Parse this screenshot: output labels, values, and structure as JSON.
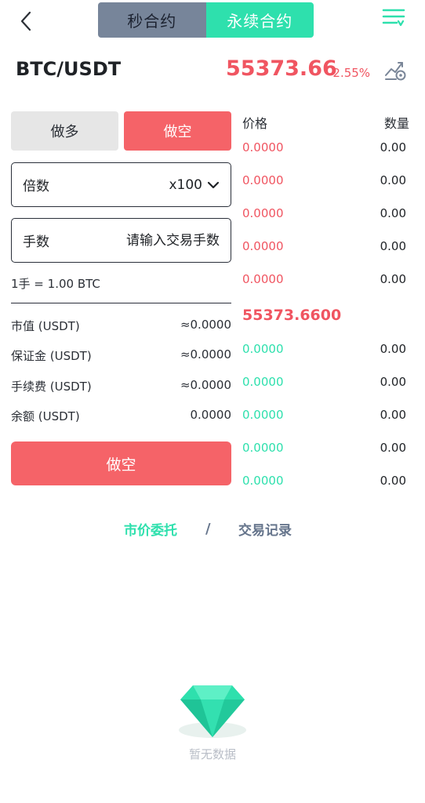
{
  "nav": {
    "tabs": [
      {
        "label": "秒合约",
        "active": false
      },
      {
        "label": "永续合约",
        "active": true
      }
    ],
    "back_icon": "chevron-left-icon",
    "menu_icon": "filter-menu-icon"
  },
  "header": {
    "pair": "BTC/USDT",
    "price": "55373.66",
    "change": "-2.55%",
    "chart_icon": "chart-settings-icon"
  },
  "form": {
    "long_label": "做多",
    "short_label": "做空",
    "leverage_label": "倍数",
    "leverage_value": "x100",
    "quantity_label": "手数",
    "quantity_placeholder": "请输入交易手数",
    "unit_note": "1手 = 1.00 BTC",
    "stats": [
      {
        "label": "市值 (USDT)",
        "value": "≈0.0000"
      },
      {
        "label": "保证金 (USDT)",
        "value": "≈0.0000"
      },
      {
        "label": "手续费 (USDT)",
        "value": "≈0.0000"
      },
      {
        "label": "余额 (USDT)",
        "value": "0.0000"
      }
    ],
    "submit_label": "做空"
  },
  "orderbook": {
    "price_header": "价格",
    "qty_header": "数量",
    "asks": [
      {
        "price": "0.0000",
        "qty": "0.00"
      },
      {
        "price": "0.0000",
        "qty": "0.00"
      },
      {
        "price": "0.0000",
        "qty": "0.00"
      },
      {
        "price": "0.0000",
        "qty": "0.00"
      },
      {
        "price": "0.0000",
        "qty": "0.00"
      }
    ],
    "mid_price": "55373.6600",
    "bids": [
      {
        "price": "0.0000",
        "qty": "0.00"
      },
      {
        "price": "0.0000",
        "qty": "0.00"
      },
      {
        "price": "0.0000",
        "qty": "0.00"
      },
      {
        "price": "0.0000",
        "qty": "0.00"
      },
      {
        "price": "0.0000",
        "qty": "0.00"
      }
    ]
  },
  "bottom_tabs": {
    "orders_label": "市价委托",
    "separator": "/",
    "history_label": "交易记录"
  },
  "empty_state": {
    "icon": "diamond-icon",
    "text": "暂无数据"
  },
  "colors": {
    "accent_green": "#2ee0ad",
    "accent_red": "#f05561",
    "short_button": "#f56368",
    "tab_inactive": "#77859a"
  }
}
